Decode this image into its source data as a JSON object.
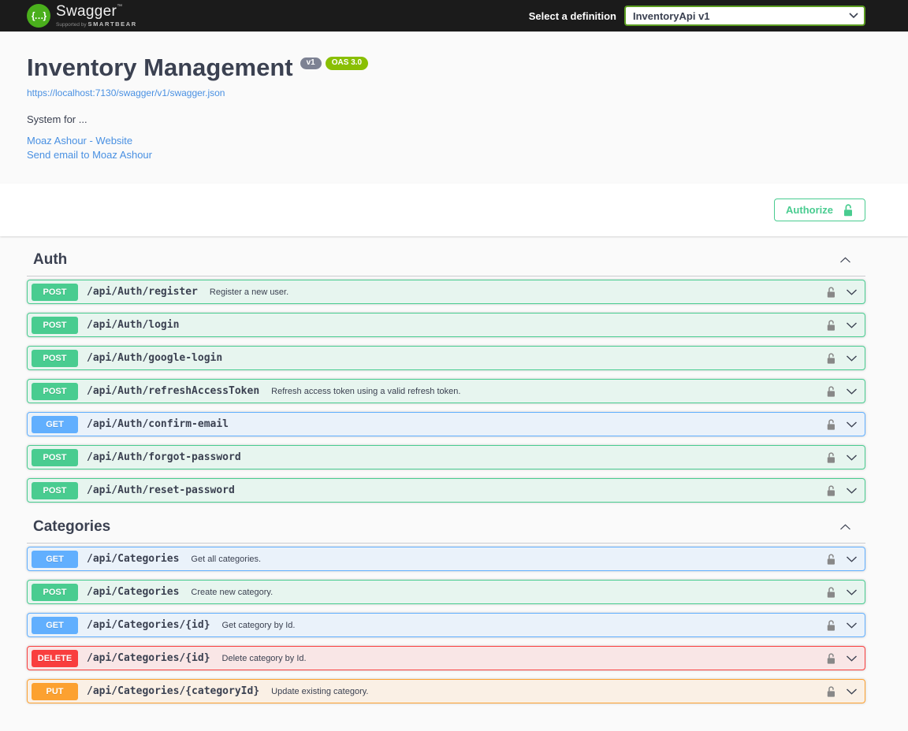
{
  "colors": {
    "topbar_bg": "#1b1b1b",
    "brand_green": "#4aaf1c",
    "select_border": "#5b9d20",
    "link_blue": "#4990e2",
    "text": "#3b4151",
    "accent_green": "#49cc90",
    "version_badge_bg": "#7d8293",
    "oas_badge_bg": "#89bf04",
    "lock_gray": "#888888",
    "methods": {
      "GET": {
        "badge": "#61affe",
        "row_bg": "rgba(97,175,254,0.1)",
        "border": "#61affe"
      },
      "POST": {
        "badge": "#49cc90",
        "row_bg": "rgba(73,204,144,0.1)",
        "border": "#49cc90"
      },
      "DELETE": {
        "badge": "#f93e3e",
        "row_bg": "rgba(249,62,62,0.1)",
        "border": "#f93e3e"
      },
      "PUT": {
        "badge": "#fca130",
        "row_bg": "rgba(252,161,48,0.1)",
        "border": "#fca130"
      }
    }
  },
  "topbar": {
    "logo_glyph": "{…}",
    "brand": "Swagger",
    "trademark": "™",
    "supported_by": "Supported by ",
    "smartbear": "SMARTBEAR",
    "select_label": "Select a definition",
    "selected_definition": "InventoryApi v1"
  },
  "info": {
    "title": "Inventory Management",
    "version_badge": "v1",
    "oas_badge": "OAS 3.0",
    "spec_url": "https://localhost:7130/swagger/v1/swagger.json",
    "description": "System for ...",
    "website_link": "Moaz Ashour - Website",
    "email_link": "Send email to Moaz Ashour"
  },
  "scheme": {
    "authorize_label": "Authorize"
  },
  "sections": [
    {
      "name": "Auth",
      "expanded": true,
      "operations": [
        {
          "method": "POST",
          "path": "/api/Auth/register",
          "summary": "Register a new user."
        },
        {
          "method": "POST",
          "path": "/api/Auth/login",
          "summary": ""
        },
        {
          "method": "POST",
          "path": "/api/Auth/google-login",
          "summary": ""
        },
        {
          "method": "POST",
          "path": "/api/Auth/refreshAccessToken",
          "summary": "Refresh access token using a valid refresh token."
        },
        {
          "method": "GET",
          "path": "/api/Auth/confirm-email",
          "summary": ""
        },
        {
          "method": "POST",
          "path": "/api/Auth/forgot-password",
          "summary": ""
        },
        {
          "method": "POST",
          "path": "/api/Auth/reset-password",
          "summary": ""
        }
      ]
    },
    {
      "name": "Categories",
      "expanded": true,
      "operations": [
        {
          "method": "GET",
          "path": "/api/Categories",
          "summary": "Get all categories."
        },
        {
          "method": "POST",
          "path": "/api/Categories",
          "summary": "Create new category."
        },
        {
          "method": "GET",
          "path": "/api/Categories/{id}",
          "summary": "Get category by Id."
        },
        {
          "method": "DELETE",
          "path": "/api/Categories/{id}",
          "summary": "Delete category by Id."
        },
        {
          "method": "PUT",
          "path": "/api/Categories/{categoryId}",
          "summary": "Update existing category."
        }
      ]
    }
  ]
}
